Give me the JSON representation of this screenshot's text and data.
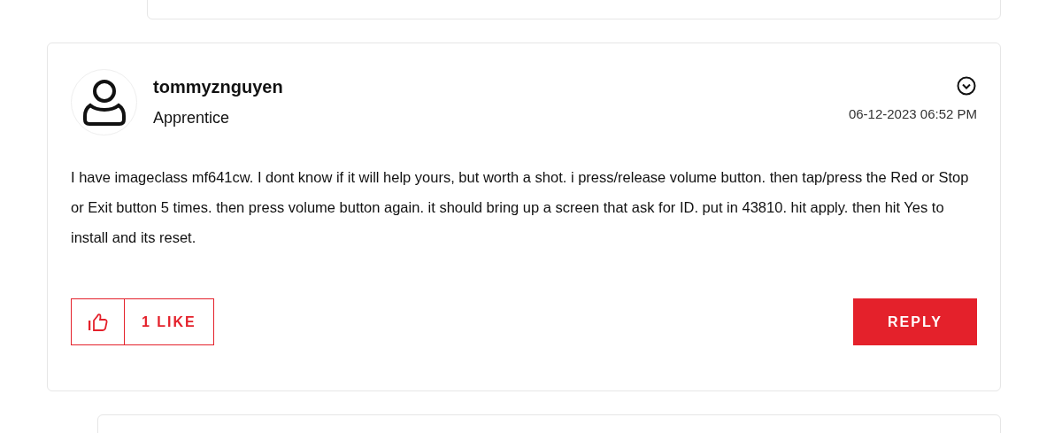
{
  "post": {
    "author": "tommyznguyen",
    "rank": "Apprentice",
    "timestamp": "06-12-2023 06:52 PM",
    "body": "I have imageclass mf641cw. I dont know if it will help yours, but worth a shot. i press/release volume button. then tap/press the Red or Stop or Exit button 5 times. then press volume button again. it should bring up a screen that ask for ID. put in 43810. hit apply. then hit Yes to install and its reset.",
    "likes": "1 LIKE",
    "reply": "REPLY"
  }
}
